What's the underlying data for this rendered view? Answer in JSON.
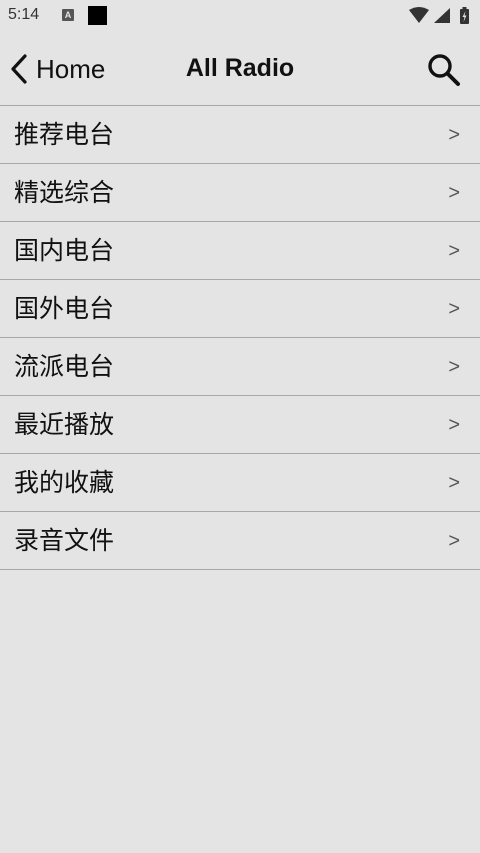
{
  "status_bar": {
    "time": "5:14",
    "notification_letter": "A",
    "icons": [
      "a-notification-icon",
      "square-notification-icon",
      "wifi-icon",
      "cell-signal-icon",
      "battery-charging-icon"
    ]
  },
  "app_bar": {
    "back_label": "Home",
    "title": "All Radio",
    "back_icon": "chevron-left-icon",
    "search_icon": "search-icon"
  },
  "menu": {
    "chevron": ">",
    "items": [
      {
        "label": "推荐电台"
      },
      {
        "label": "精选综合"
      },
      {
        "label": "国内电台"
      },
      {
        "label": "国外电台"
      },
      {
        "label": "流派电台"
      },
      {
        "label": "最近播放"
      },
      {
        "label": "我的收藏"
      },
      {
        "label": "录音文件"
      }
    ]
  },
  "colors": {
    "background": "#e4e4e4",
    "divider": "#a8a8a8",
    "text": "#111111",
    "chevron": "#555555"
  }
}
